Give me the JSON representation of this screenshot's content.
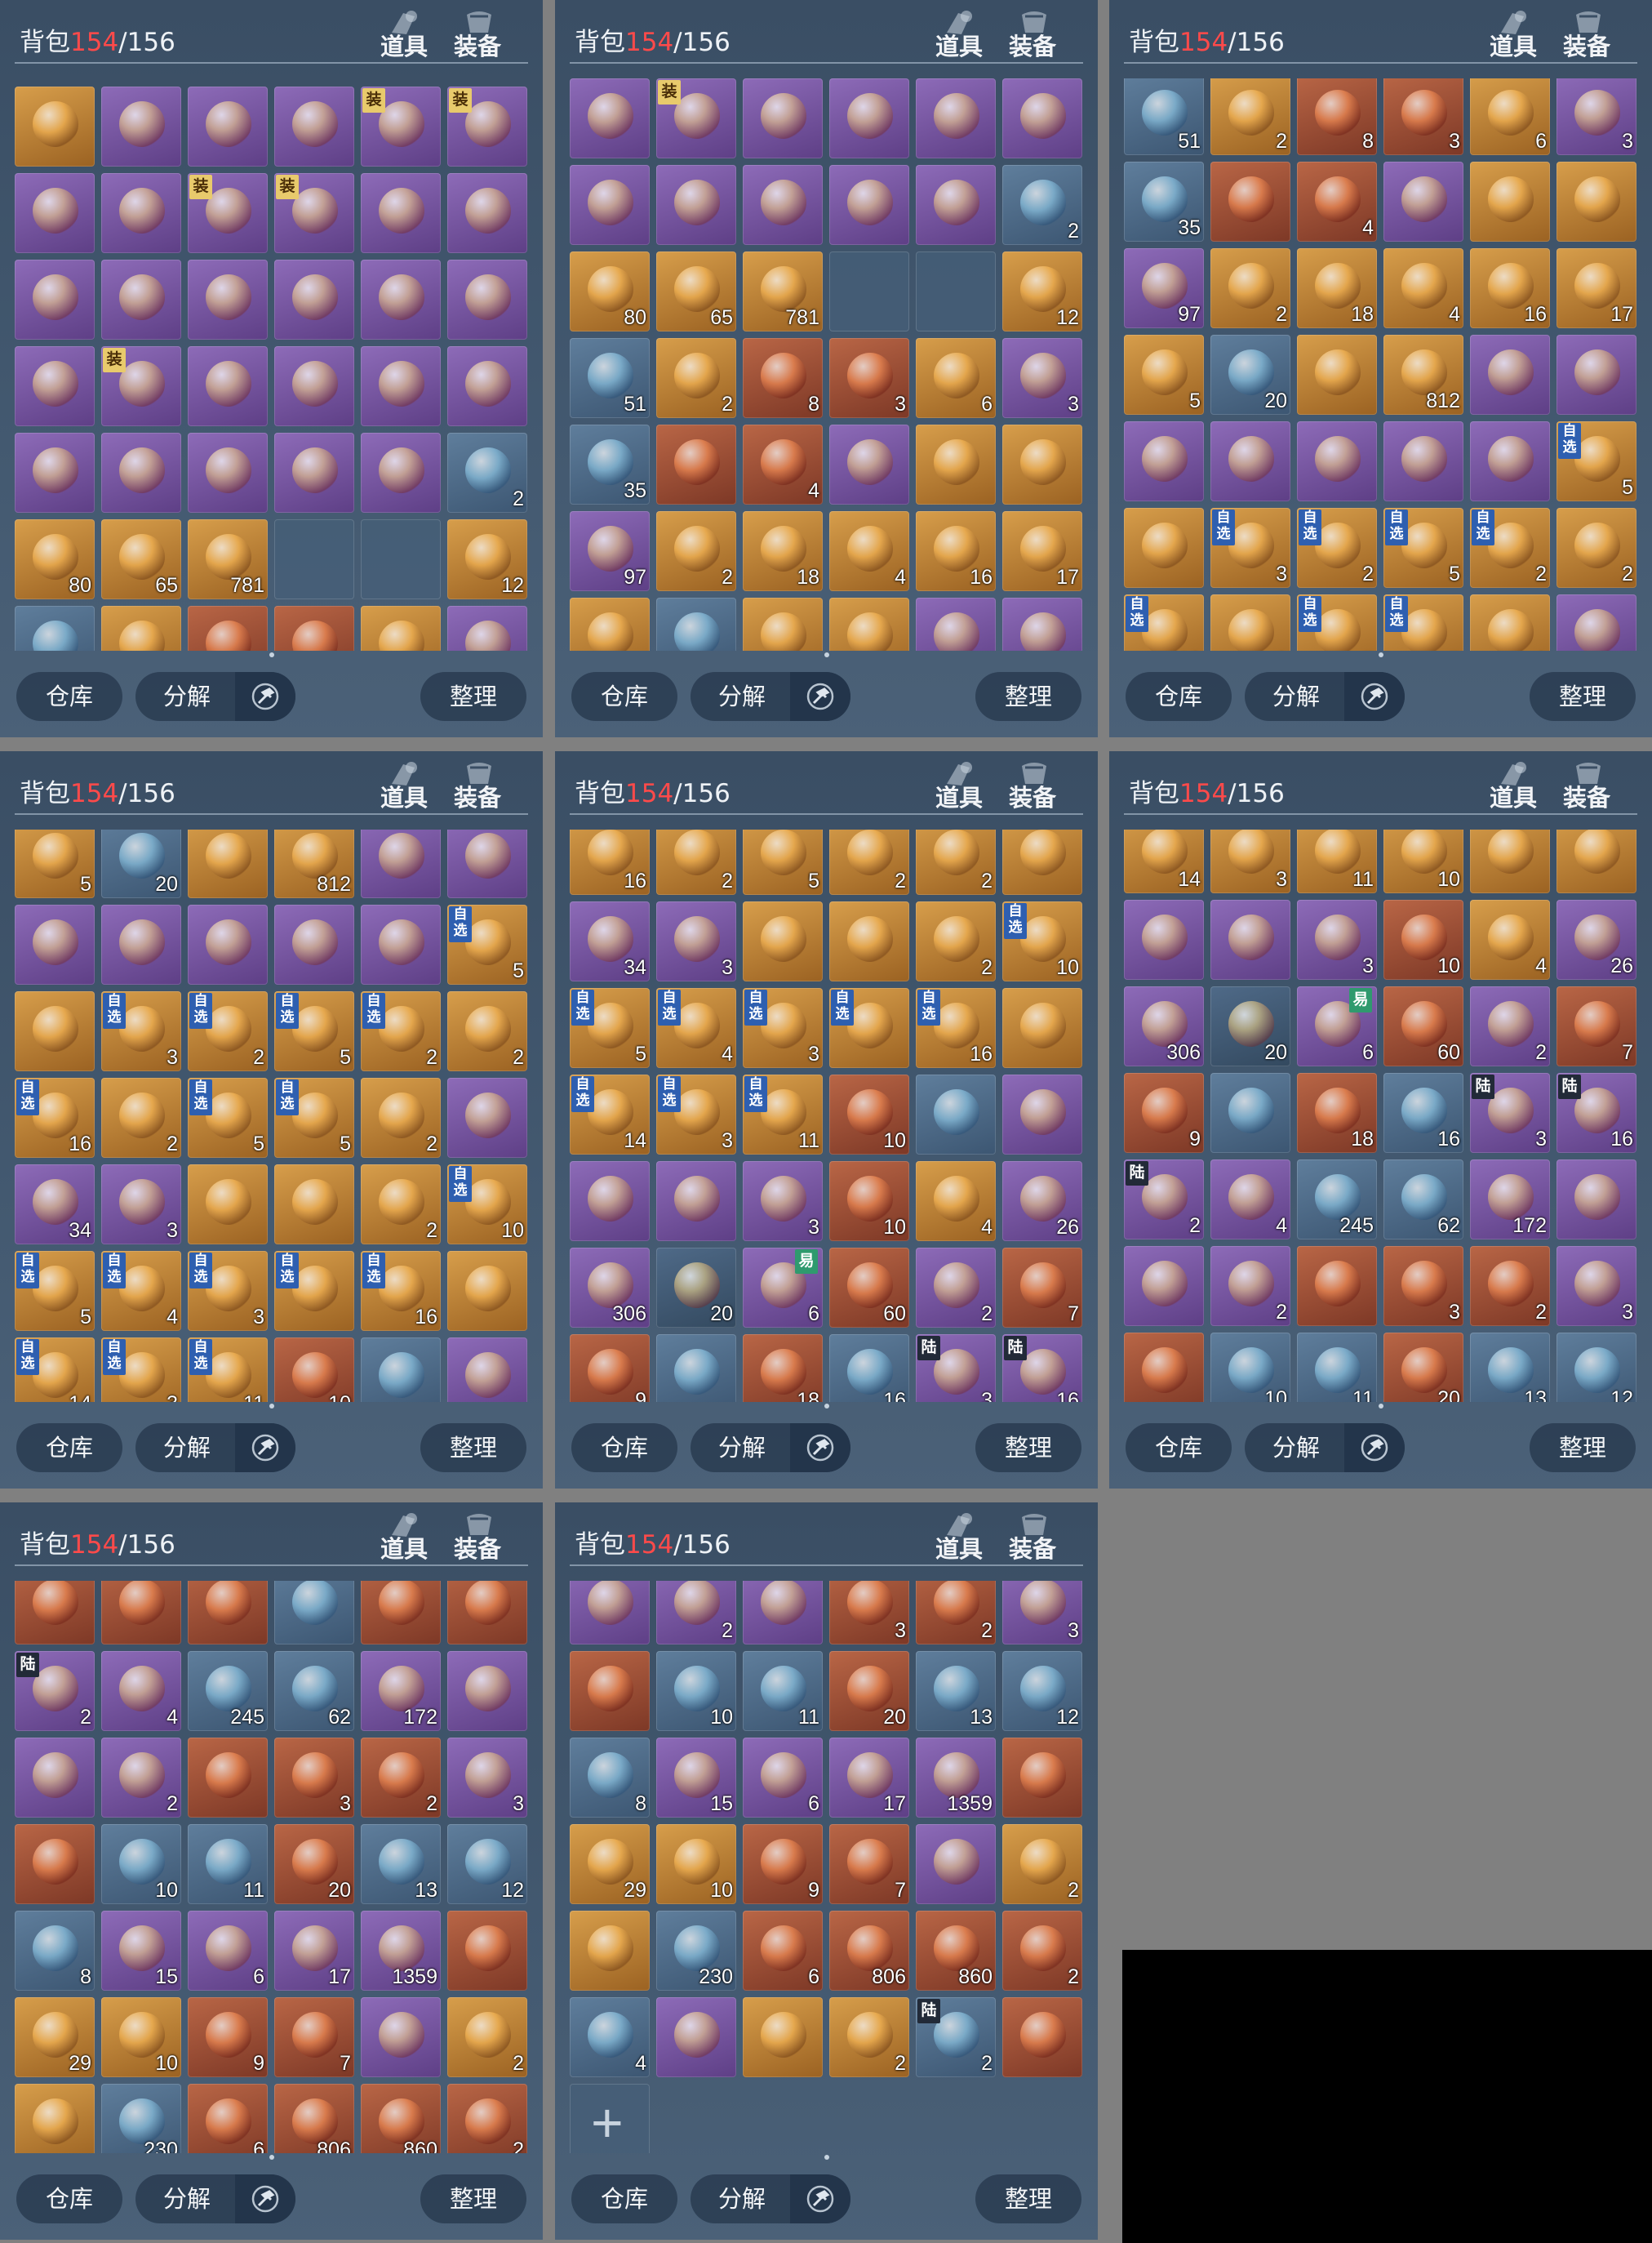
{
  "header": {
    "title": "背包",
    "count": "154",
    "capacity": "/156",
    "tab_items": "道具",
    "tab_equip": "装备"
  },
  "footer": {
    "warehouse": "仓库",
    "decompose": "分解",
    "sort": "整理"
  },
  "colors": {
    "count": "#ff4a4a",
    "panel": "#42586f",
    "button": "#2a3c52"
  },
  "icons": {
    "tab_items": "box-icon",
    "tab_equip": "armor-icon",
    "decompose": "hammer-icon",
    "add": "plus-icon"
  },
  "panels": [
    {
      "rows": [
        [
          "o",
          "p",
          "p",
          "p",
          "p:装",
          "p:装"
        ],
        [
          "p",
          "p",
          "p:装",
          "p:装",
          "p",
          "p"
        ],
        [
          "p",
          "p",
          "p",
          "p",
          "p",
          "p"
        ],
        [
          "p",
          "p:装",
          "p",
          "p",
          "p",
          "p"
        ],
        [
          "p",
          "p",
          "p",
          "p",
          "p",
          "b|2"
        ],
        [
          "o|80",
          "o|65",
          "o|781",
          "e",
          "e",
          "o|12"
        ],
        [
          "b",
          "o",
          "r",
          "r",
          "o",
          "p"
        ]
      ]
    },
    {
      "rows": [
        [
          "p",
          "p:装",
          "p",
          "p",
          "p",
          "p"
        ],
        [
          "p",
          "p",
          "p",
          "p",
          "p",
          "b|2"
        ],
        [
          "o|80",
          "o|65",
          "o|781",
          "e",
          "e",
          "o|12"
        ],
        [
          "b|51",
          "o|2",
          "r|8",
          "r|3",
          "o|6",
          "p|3"
        ],
        [
          "b|35",
          "r",
          "r|4",
          "p",
          "o",
          "o"
        ],
        [
          "p|97",
          "o|2",
          "o|18",
          "o|4",
          "o|16",
          "o|17"
        ],
        [
          "o",
          "b",
          "o",
          "o",
          "p",
          "p"
        ]
      ]
    },
    {
      "rows": [
        [
          "b|51",
          "o|2",
          "r|8",
          "r|3",
          "o|6",
          "p|3"
        ],
        [
          "b|35",
          "r",
          "r|4",
          "p",
          "o",
          "o"
        ],
        [
          "p|97",
          "o|2",
          "o|18",
          "o|4",
          "o|16",
          "o|17"
        ],
        [
          "o|5",
          "b|20",
          "o",
          "o|812",
          "p",
          "p"
        ],
        [
          "p",
          "p",
          "p",
          "p",
          "p",
          "o:自选|5"
        ],
        [
          "o",
          "o:自选|3",
          "o:自选|2",
          "o:自选|5",
          "o:自选|2",
          "o|2"
        ],
        [
          "o:自选|16",
          "o|2",
          "o:自选|5",
          "o:自选|5",
          "o|2",
          "p"
        ]
      ]
    },
    {
      "rows": [
        [
          "o|5",
          "b|20",
          "o",
          "o|812",
          "p",
          "p"
        ],
        [
          "p",
          "p",
          "p",
          "p",
          "p",
          "o:自选|5"
        ],
        [
          "o",
          "o:自选|3",
          "o:自选|2",
          "o:自选|5",
          "o:自选|2",
          "o|2"
        ],
        [
          "o:自选|16",
          "o|2",
          "o:自选|5",
          "o:自选|5",
          "o|2",
          "p"
        ],
        [
          "p|34",
          "p|3",
          "o",
          "o",
          "o|2",
          "o:自选|10"
        ],
        [
          "o:自选|5",
          "o:自选|4",
          "o:自选|3",
          "o:自选",
          "o:自选|16",
          "o"
        ],
        [
          "o:自选|14",
          "o:自选|3",
          "o:自选|11",
          "r|10",
          "b",
          "p"
        ]
      ]
    },
    {
      "rows": [
        [
          "o|16",
          "o|2",
          "o|5",
          "o|2",
          "o|2",
          "o"
        ],
        [
          "p|34",
          "p|3",
          "o",
          "o",
          "o|2",
          "o:自选|10"
        ],
        [
          "o:自选|5",
          "o:自选|4",
          "o:自选|3",
          "o:自选",
          "o:自选|16",
          "o"
        ],
        [
          "o:自选|14",
          "o:自选|3",
          "o:自选|11",
          "r|10",
          "b",
          "p"
        ],
        [
          "p",
          "p",
          "p|3",
          "r|10",
          "o|4",
          "p|26"
        ],
        [
          "p|306",
          "a|20",
          "p:易|6",
          "r|60",
          "p|2",
          "r|7"
        ],
        [
          "r|9",
          "b",
          "r|18",
          "b|16",
          "p:陆|3",
          "p:陆|16"
        ]
      ]
    },
    {
      "rows": [
        [
          "o|14",
          "o|3",
          "o|11",
          "o|10",
          "o",
          "o"
        ],
        [
          "p",
          "p",
          "p|3",
          "r|10",
          "o|4",
          "p|26"
        ],
        [
          "p|306",
          "a|20",
          "p:易|6",
          "r|60",
          "p|2",
          "r|7"
        ],
        [
          "r|9",
          "b",
          "r|18",
          "b|16",
          "p:陆|3",
          "p:陆|16"
        ],
        [
          "p:陆|2",
          "p|4",
          "b|245",
          "b|62",
          "p|172",
          "p"
        ],
        [
          "p",
          "p|2",
          "r",
          "r|3",
          "r|2",
          "p|3"
        ],
        [
          "r",
          "b|10",
          "b|11",
          "r|20",
          "b|13",
          "b|12"
        ]
      ]
    },
    {
      "rows": [
        [
          "r",
          "r",
          "r",
          "b",
          "r",
          "r"
        ],
        [
          "p:陆|2",
          "p|4",
          "b|245",
          "b|62",
          "p|172",
          "p"
        ],
        [
          "p",
          "p|2",
          "r",
          "r|3",
          "r|2",
          "p|3"
        ],
        [
          "r",
          "b|10",
          "b|11",
          "r|20",
          "b|13",
          "b|12"
        ],
        [
          "b|8",
          "p|15",
          "p|6",
          "p|17",
          "p|1359",
          "r"
        ],
        [
          "o|29",
          "o|10",
          "r|9",
          "r|7",
          "p",
          "o|2"
        ],
        [
          "o",
          "b|230",
          "r|6",
          "r|806",
          "r|860",
          "r|2"
        ]
      ]
    },
    {
      "rows": [
        [
          "p",
          "p|2",
          "p",
          "r|3",
          "r|2",
          "p|3"
        ],
        [
          "r",
          "b|10",
          "b|11",
          "r|20",
          "b|13",
          "b|12"
        ],
        [
          "b|8",
          "p|15",
          "p|6",
          "p|17",
          "p|1359",
          "r"
        ],
        [
          "o|29",
          "o|10",
          "r|9",
          "r|7",
          "p",
          "o|2"
        ],
        [
          "o",
          "b|230",
          "r|6",
          "r|806",
          "r|860",
          "r|2"
        ],
        [
          "b|4",
          "p",
          "o",
          "o|2",
          "b:陆|2",
          "r"
        ],
        [
          "add"
        ]
      ]
    }
  ]
}
